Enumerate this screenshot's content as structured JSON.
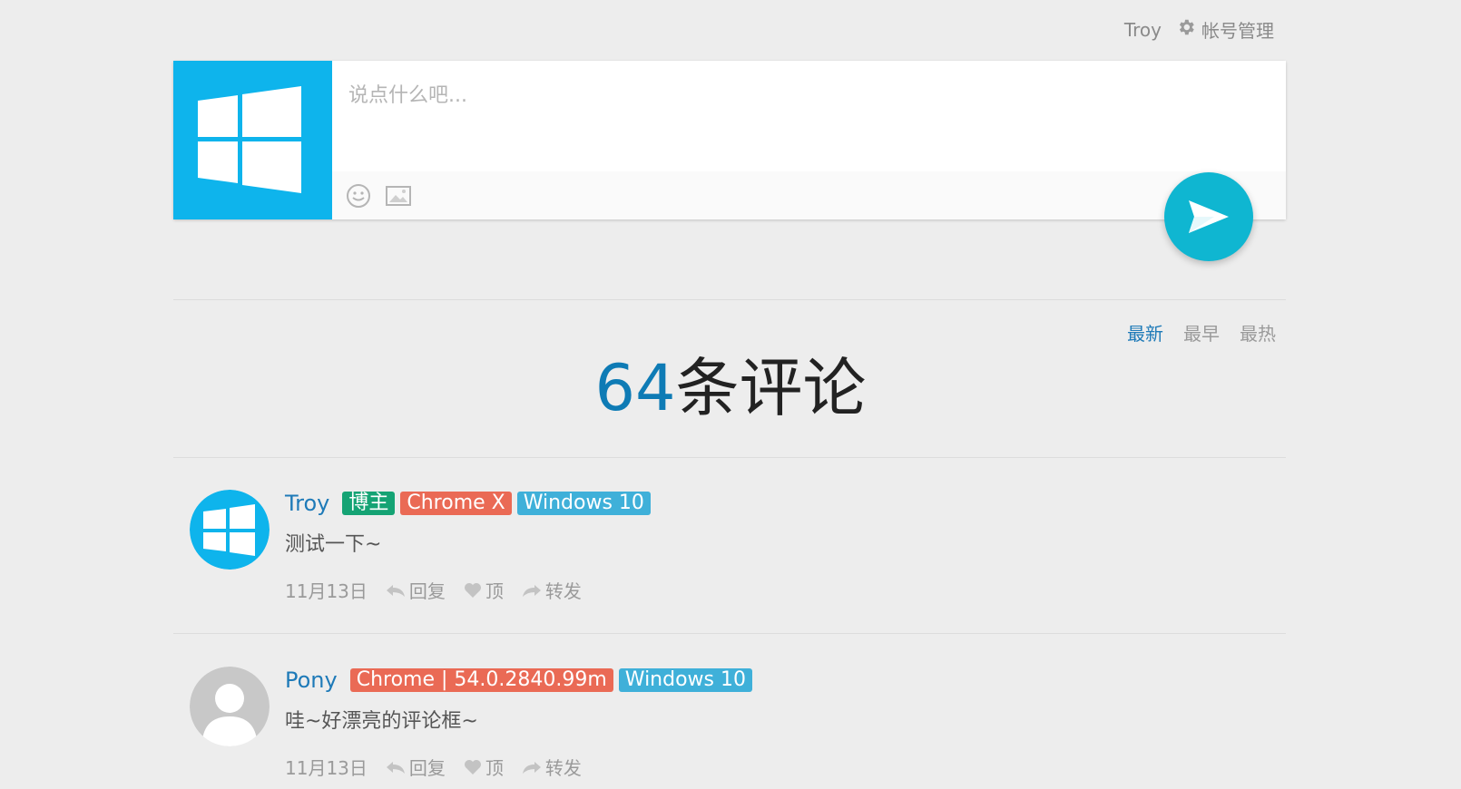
{
  "topbar": {
    "username": "Troy",
    "account_label": "帐号管理"
  },
  "composer": {
    "placeholder": "说点什么吧..."
  },
  "sort": {
    "tabs": [
      {
        "label": "最新",
        "active": true
      },
      {
        "label": "最早",
        "active": false
      },
      {
        "label": "最热",
        "active": false
      }
    ]
  },
  "count": {
    "number": "64",
    "label": "条评论"
  },
  "comments": [
    {
      "name": "Troy",
      "badges": [
        {
          "text": "博主",
          "color": "#15a374"
        },
        {
          "text": "Chrome X",
          "color": "#ea6a55"
        },
        {
          "text": "Windows 10",
          "color": "#3fb0d9"
        }
      ],
      "text": "测试一下~",
      "date": "11月13日",
      "reply": "回复",
      "like": "顶",
      "share": "转发",
      "avatar": "windows-logo"
    },
    {
      "name": "Pony",
      "badges": [
        {
          "text": "Chrome | 54.0.2840.99m",
          "color": "#ea6a55"
        },
        {
          "text": "Windows 10",
          "color": "#3fb0d9"
        }
      ],
      "text": "哇~好漂亮的评论框~",
      "date": "11月13日",
      "reply": "回复",
      "like": "顶",
      "share": "转发",
      "avatar": "default-user"
    }
  ],
  "colors": {
    "accent": "#0e7bb5",
    "send": "#0fb6d1",
    "brand_tile": "#0eb4ec"
  }
}
